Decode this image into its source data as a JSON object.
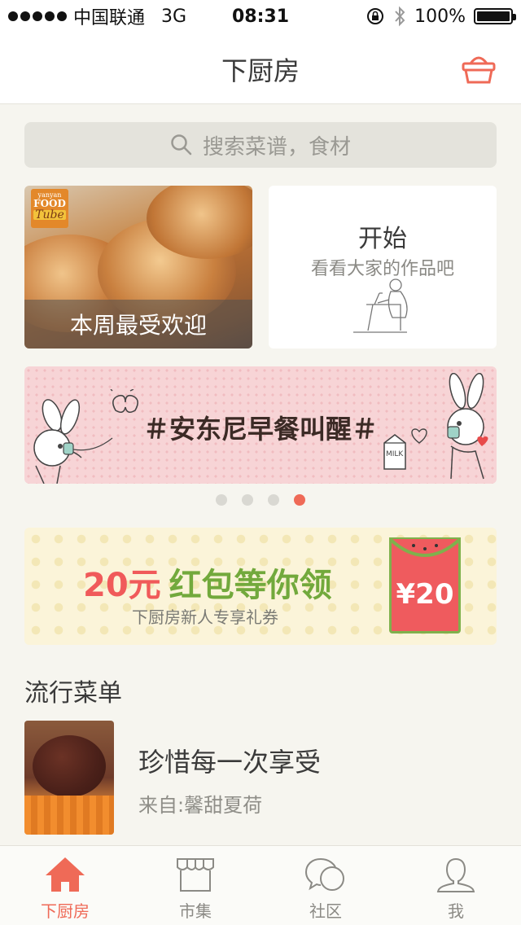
{
  "status_bar": {
    "carrier": "中国联通",
    "network": "3G",
    "time": "08:31",
    "battery": "100%"
  },
  "nav": {
    "title": "下厨房",
    "cart_icon": "basket-icon"
  },
  "search": {
    "placeholder": "搜索菜谱，食材"
  },
  "cards": {
    "left": {
      "caption": "本周最受欢迎",
      "logo": {
        "top": "yanyan",
        "mid": "FOOD",
        "bottom": "Tube"
      }
    },
    "right": {
      "title": "开始",
      "subtitle": "看看大家的作品吧"
    }
  },
  "banner": {
    "text": "＃安东尼早餐叫醒＃",
    "milk_label": "MILK",
    "page_count": 4,
    "active_page": 4
  },
  "coupon": {
    "amount": "20元",
    "title": "红包等你领",
    "subtitle": "下厨房新人专享礼券",
    "packet_value": "¥20"
  },
  "section": {
    "title": "流行菜单"
  },
  "list": [
    {
      "title": "珍惜每一次享受",
      "subtitle": "来自:馨甜夏荷"
    }
  ],
  "tabs": [
    {
      "label": "下厨房",
      "icon": "home-icon",
      "active": true
    },
    {
      "label": "市集",
      "icon": "shop-icon",
      "active": false
    },
    {
      "label": "社区",
      "icon": "chat-icon",
      "active": false
    },
    {
      "label": "我",
      "icon": "user-icon",
      "active": false
    }
  ],
  "colors": {
    "accent": "#ef6a57",
    "background": "#f6f5ef",
    "coupon_green": "#72a93c",
    "coupon_red": "#f05a5a"
  }
}
